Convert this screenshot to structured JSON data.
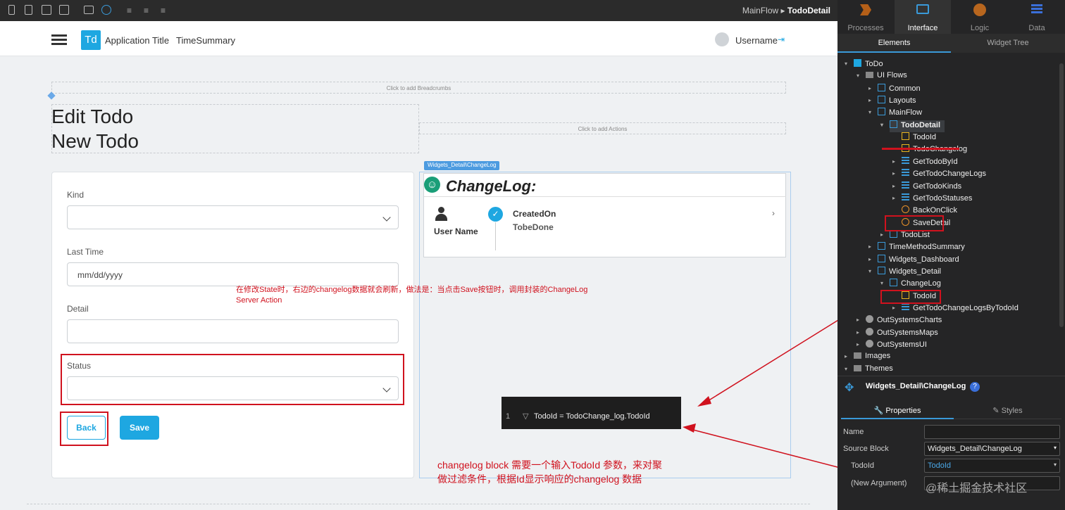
{
  "breadcrumb": {
    "flow": "MainFlow",
    "screen": "TodoDetail"
  },
  "app_header": {
    "logo": "Td",
    "app_title": "Application Title",
    "nav_item": "TimeSummary",
    "username": "Username"
  },
  "placeholders": {
    "breadcrumbs": "Click to add Breadcrumbs",
    "actions": "Click to add Actions"
  },
  "titles": {
    "edit": "Edit Todo",
    "new": "New Todo"
  },
  "form": {
    "kind_label": "Kind",
    "last_time_label": "Last Time",
    "last_time_placeholder": "mm/dd/yyyy",
    "detail_label": "Detail",
    "status_label": "Status",
    "back_label": "Back",
    "save_label": "Save"
  },
  "changelog": {
    "block_tag": "Widgets_Detail\\ChangeLog",
    "title": "ChangeLog:",
    "user_name": "User Name",
    "created_on": "CreatedOn",
    "status": "TobeDone"
  },
  "annotations": {
    "note_line1": "在修改State时，右边的changelog数据就会刷新，做法是：当点击Save按钮时，调用封装的ChangeLog",
    "note_line2": "Server Action",
    "filter_index": "1",
    "filter_text": "TodoId = TodoChange_log.TodoId",
    "bottom_note_line1": "changelog  block 需要一个输入TodoId 参数，来对聚",
    "bottom_note_line2": "做过滤条件，根据Id显示响应的changelog 数据"
  },
  "panel": {
    "tabs": [
      "Processes",
      "Interface",
      "Logic",
      "Data"
    ],
    "subtabs": [
      "Elements",
      "Widget Tree"
    ],
    "tree": [
      "ToDo",
      "UI Flows",
      "Common",
      "Layouts",
      "MainFlow",
      "TodoDetail",
      "TodoId",
      "TodoChangelog",
      "GetTodoById",
      "GetTodoChangeLogs",
      "GetTodoKinds",
      "GetTodoStatuses",
      "BackOnClick",
      "SaveDetail",
      "TodoList",
      "TimeMethodSummary",
      "Widgets_Dashboard",
      "Widgets_Detail",
      "ChangeLog",
      "TodoId",
      "GetTodoChangeLogsByTodoId",
      "OutSystemsCharts",
      "OutSystemsMaps",
      "OutSystemsUI",
      "Images",
      "Themes"
    ],
    "selected_title": "Widgets_Detail\\ChangeLog",
    "prop_tabs": [
      "Properties",
      "Styles"
    ],
    "props": {
      "name_label": "Name",
      "source_label": "Source Block",
      "source_value": "Widgets_Detail\\ChangeLog",
      "todoid_label": "TodoId",
      "todoid_value": "TodoId",
      "new_arg_label": "(New Argument)"
    },
    "watermark": "@稀土掘金技术社区"
  },
  "colors": {
    "accent": "#1ea7e1",
    "annotation_red": "#d0121e",
    "panel_bg": "#252526"
  }
}
